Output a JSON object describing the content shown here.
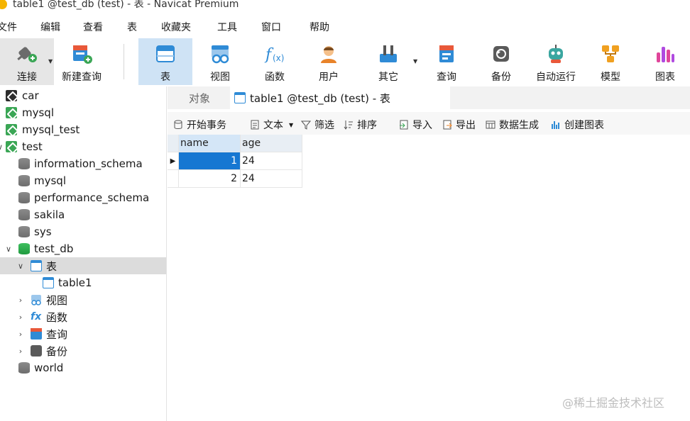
{
  "window": {
    "title": "table1 @test_db (test) - 表 - Navicat Premium"
  },
  "menu": [
    "文件",
    "编辑",
    "查看",
    "表",
    "收藏夹",
    "工具",
    "窗口",
    "帮助"
  ],
  "toolbar": {
    "connect": "连接",
    "new_query": "新建查询",
    "table": "表",
    "view": "视图",
    "function": "函数",
    "user": "用户",
    "other": "其它",
    "query": "查询",
    "backup": "备份",
    "automation": "自动运行",
    "model": "模型",
    "chart": "图表"
  },
  "tree": {
    "car": "car",
    "mysql": "mysql",
    "mysql_test": "mysql_test",
    "test": "test",
    "information_schema": "information_schema",
    "mysql_db": "mysql",
    "performance_schema": "performance_schema",
    "sakila": "sakila",
    "sys": "sys",
    "test_db": "test_db",
    "tables": "表",
    "table1": "table1",
    "views": "视图",
    "functions": "函数",
    "queries": "查询",
    "backups": "备份",
    "world": "world"
  },
  "tabs": {
    "objects": "对象",
    "active": "table1 @test_db (test) - 表"
  },
  "subtoolbar": {
    "begin_tx": "开始事务",
    "text": "文本",
    "filter": "筛选",
    "sort": "排序",
    "import": "导入",
    "export": "导出",
    "data_gen": "数据生成",
    "create_chart": "创建图表"
  },
  "grid": {
    "columns": [
      "name",
      "age"
    ],
    "rows": [
      [
        "1",
        "24"
      ],
      [
        "2",
        "24"
      ]
    ]
  },
  "watermark": "@稀土掘金技术社区",
  "colors": {
    "accent": "#1677d2",
    "active_tool": "#cfe3f5",
    "connected": "#3aa655"
  }
}
